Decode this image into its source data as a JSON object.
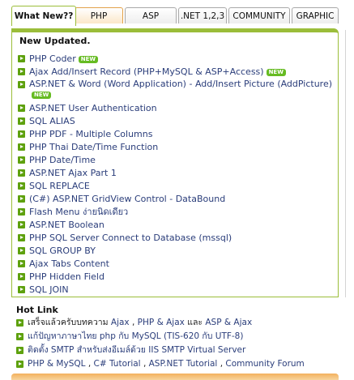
{
  "tabs": [
    {
      "label": "What New??"
    },
    {
      "label": "PHP"
    },
    {
      "label": "ASP"
    },
    {
      "label": ".NET 1,2,3"
    },
    {
      "label": "COMMUNITY"
    },
    {
      "label": "GRAPHIC"
    }
  ],
  "panel_title": "New Updated.",
  "new_badge": "NEW",
  "items": [
    {
      "text": "PHP Coder"
    },
    {
      "text": "Ajax Add/Insert Record (PHP+MySQL & ASP+Access)"
    },
    {
      "text": "ASP.NET & Word (Word Application) - Add/Insert Picture (AddPicture)"
    },
    {
      "text": "ASP.NET User Authentication"
    },
    {
      "text": "SQL ALIAS"
    },
    {
      "text": "PHP PDF - Multiple Columns"
    },
    {
      "text": "PHP Thai Date/Time Function"
    },
    {
      "text": "PHP Date/Time"
    },
    {
      "text": "ASP.NET Ajax Part 1"
    },
    {
      "text": "SQL REPLACE"
    },
    {
      "text": "(C#) ASP.NET GridView Control - DataBound"
    },
    {
      "text": "Flash Menu ง่ายนิดเดียว"
    },
    {
      "text": "ASP.NET Boolean"
    },
    {
      "text": "PHP SQL Server Connect to Database (mssql)"
    },
    {
      "text": "SQL GROUP BY"
    },
    {
      "text": "Ajax Tabs Content"
    },
    {
      "text": "PHP Hidden Field"
    },
    {
      "text": "SQL JOIN"
    }
  ],
  "hot_title": "Hot Link",
  "hot": {
    "line1_prefix": "เสร็จแล้วครับบทความ",
    "line1_link1": "Ajax",
    "line1_sep1": ",",
    "line1_link2": "PHP & Ajax",
    "line1_and": "และ",
    "line1_link3": "ASP & Ajax",
    "line2": "แก้ปัญหาภาษาไทย php กับ MySQL (TIS-620 กับ UTF-8)",
    "line3": "ติดตั้ง SMTP สำหรับส่งอีเมล์ด้วย IIS SMTP Virtual Server",
    "line4_links": [
      "PHP & MySQL",
      "C# Tutorial",
      "ASP.NET Tutorial",
      "Community Forum"
    ],
    "line4_sep": ","
  },
  "colors": {
    "accent": "#9bbd3a",
    "orange": "#e2a24b",
    "link": "#2a3d7a",
    "bullet": "#5ea10e"
  }
}
